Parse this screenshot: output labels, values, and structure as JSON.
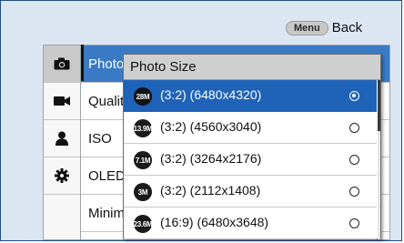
{
  "header": {
    "menu_button": "Menu",
    "back_label": "Back"
  },
  "sidebar": {
    "items": [
      {
        "icon": "camera-icon",
        "active": true
      },
      {
        "icon": "video-camera-icon",
        "active": false
      },
      {
        "icon": "person-icon",
        "active": false
      },
      {
        "icon": "gear-icon",
        "active": false
      }
    ]
  },
  "settings": {
    "rows": [
      {
        "label": "Photo"
      },
      {
        "label": "Quality"
      },
      {
        "label": "ISO"
      },
      {
        "label": "OLED"
      },
      {
        "label": "Minimum"
      }
    ]
  },
  "dropdown": {
    "title": "Photo Size",
    "options": [
      {
        "badge": "28M",
        "label": "(3:2) (6480x4320)",
        "selected": true
      },
      {
        "badge": "13.9M",
        "label": "(3:2) (4560x3040)",
        "selected": false
      },
      {
        "badge": "7.1M",
        "label": "(3:2) (3264x2176)",
        "selected": false
      },
      {
        "badge": "3M",
        "label": "(3:2) (2112x1408)",
        "selected": false
      },
      {
        "badge": "23.6M",
        "label": "(16:9) (6480x3648)",
        "selected": false
      }
    ]
  },
  "colors": {
    "selection": "#1e63b8",
    "frame_border": "#1f4f82",
    "background": "#dbe6f2"
  }
}
